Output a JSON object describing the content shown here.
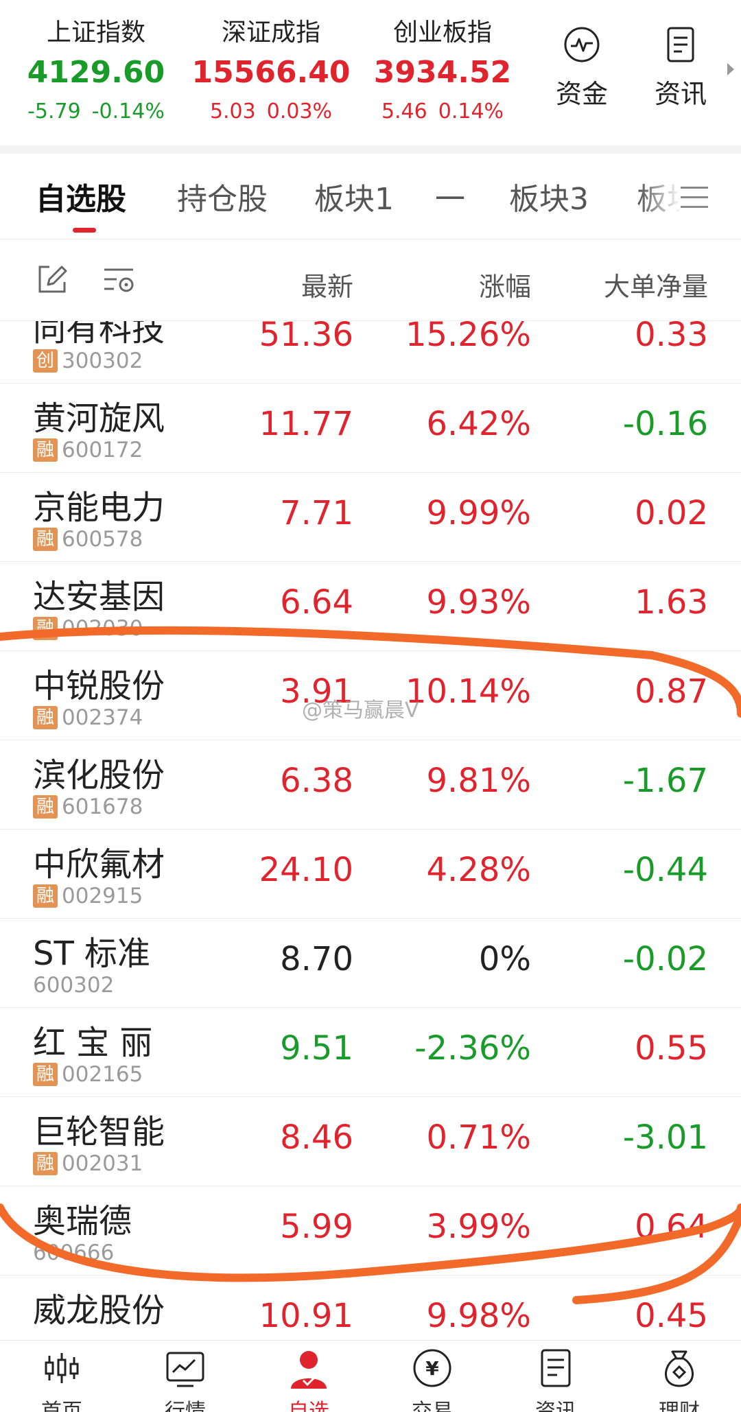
{
  "indices": [
    {
      "name": "上证指数",
      "value": "4129.60",
      "change": "-5.79",
      "pct": "-0.14%",
      "trend": "down"
    },
    {
      "name": "深证成指",
      "value": "15566.40",
      "change": "5.03",
      "pct": "0.03%",
      "trend": "up"
    },
    {
      "name": "创业板指",
      "value": "3934.52",
      "change": "5.46",
      "pct": "0.14%",
      "trend": "up"
    }
  ],
  "tools": [
    {
      "label": "资金",
      "icon": "fund-flow-icon"
    },
    {
      "label": "资讯",
      "icon": "news-icon"
    }
  ],
  "tabs": [
    "自选股",
    "持仓股",
    "板块1",
    "一",
    "板块3",
    "板块"
  ],
  "active_tab": 0,
  "columns": {
    "latest": "最新",
    "change": "涨幅",
    "net": "大单净量"
  },
  "stocks": [
    {
      "name": "同有科技",
      "badge": "创",
      "code": "300302",
      "price": "51.36",
      "pct": "15.26%",
      "net": "0.33",
      "price_trend": "up",
      "net_trend": "up"
    },
    {
      "name": "黄河旋风",
      "badge": "融",
      "code": "600172",
      "price": "11.77",
      "pct": "6.42%",
      "net": "-0.16",
      "price_trend": "up",
      "net_trend": "down"
    },
    {
      "name": "京能电力",
      "badge": "融",
      "code": "600578",
      "price": "7.71",
      "pct": "9.99%",
      "net": "0.02",
      "price_trend": "up",
      "net_trend": "up"
    },
    {
      "name": "达安基因",
      "badge": "融",
      "code": "002030",
      "price": "6.64",
      "pct": "9.93%",
      "net": "1.63",
      "price_trend": "up",
      "net_trend": "up"
    },
    {
      "name": "中锐股份",
      "badge": "融",
      "code": "002374",
      "price": "3.91",
      "pct": "10.14%",
      "net": "0.87",
      "price_trend": "up",
      "net_trend": "up"
    },
    {
      "name": "滨化股份",
      "badge": "融",
      "code": "601678",
      "price": "6.38",
      "pct": "9.81%",
      "net": "-1.67",
      "price_trend": "up",
      "net_trend": "down"
    },
    {
      "name": "中欣氟材",
      "badge": "融",
      "code": "002915",
      "price": "24.10",
      "pct": "4.28%",
      "net": "-0.44",
      "price_trend": "up",
      "net_trend": "down"
    },
    {
      "name": "ST 标准",
      "badge": "",
      "code": "600302",
      "price": "8.70",
      "pct": "0%",
      "net": "-0.02",
      "price_trend": "flat",
      "net_trend": "down"
    },
    {
      "name": "红 宝 丽",
      "badge": "融",
      "code": "002165",
      "price": "9.51",
      "pct": "-2.36%",
      "net": "0.55",
      "price_trend": "down",
      "net_trend": "up"
    },
    {
      "name": "巨轮智能",
      "badge": "融",
      "code": "002031",
      "price": "8.46",
      "pct": "0.71%",
      "net": "-3.01",
      "price_trend": "up",
      "net_trend": "down"
    },
    {
      "name": "奥瑞德",
      "badge": "",
      "code": "600666",
      "price": "5.99",
      "pct": "3.99%",
      "net": "0.64",
      "price_trend": "up",
      "net_trend": "up"
    },
    {
      "name": "威龙股份",
      "badge": "",
      "code": "",
      "price": "10.91",
      "pct": "9.98%",
      "net": "0.45",
      "price_trend": "up",
      "net_trend": "up"
    }
  ],
  "watermark": "@策马赢晨V",
  "bottom_nav": [
    {
      "label": "首页",
      "icon": "home-kline-icon"
    },
    {
      "label": "行情",
      "icon": "market-chart-icon"
    },
    {
      "label": "自选",
      "icon": "watchlist-user-icon"
    },
    {
      "label": "交易",
      "icon": "trade-yuan-icon"
    },
    {
      "label": "资讯",
      "icon": "news-doc-icon"
    },
    {
      "label": "理财",
      "icon": "wealth-bag-icon"
    }
  ],
  "colors": {
    "up": "#e0242d",
    "down": "#199b29",
    "badge": "#e39455",
    "annotation": "#f26a2a",
    "accent": "#e0242d"
  }
}
